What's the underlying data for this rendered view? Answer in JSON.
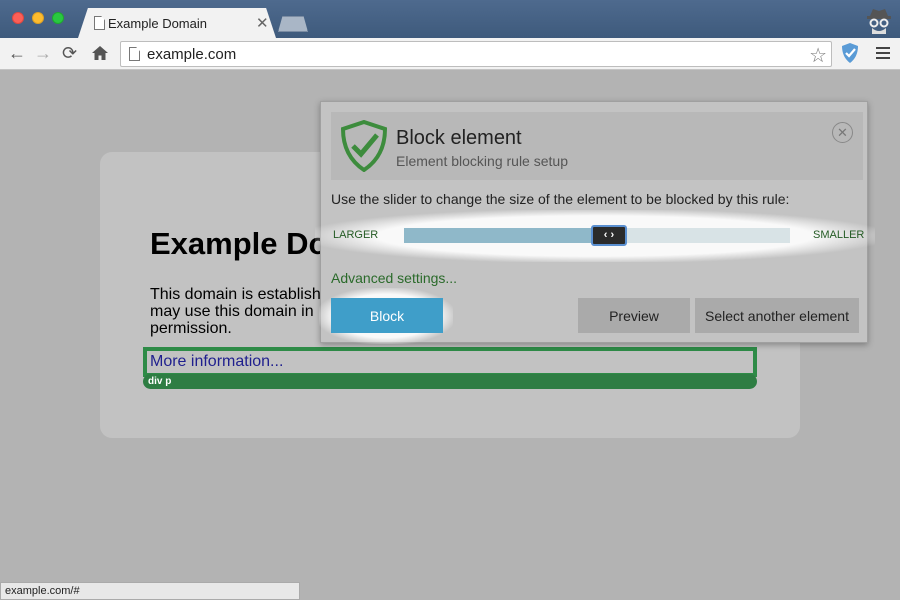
{
  "browser": {
    "tab_title": "Example Domain",
    "tab_close": "✕",
    "url": "example.com",
    "nav": {
      "back": "←",
      "forward": "→",
      "reload": "⟳"
    },
    "star": "☆"
  },
  "page": {
    "heading": "Example Do",
    "paragraph": "This domain is establish may use this domain in permission.",
    "link": "More information...",
    "selector_tag": "div p"
  },
  "status_bar": {
    "text": "example.com/#"
  },
  "dialog": {
    "title": "Block element",
    "subtitle": "Element blocking rule setup",
    "close": "✕",
    "instruction": "Use the slider to change the size of the element to be blocked by this rule:",
    "slider": {
      "left_label": "LARGER",
      "right_label": "SMALLER",
      "handle_glyph": "‹ ›",
      "position_fraction": 0.5
    },
    "advanced_link": "Advanced settings...",
    "buttons": {
      "block": "Block",
      "preview": "Preview",
      "select_another": "Select another element"
    }
  },
  "colors": {
    "accent_green": "#2e8b47",
    "block_button": "#3f9ec9",
    "slider_fill": "#8fb8c9",
    "slider_track": "#d8e3e6"
  },
  "icons": {
    "tab": "page-icon",
    "incognito": "incognito-icon",
    "home": "home-icon",
    "bookmark": "star-icon",
    "extension": "adguard-shield-icon",
    "menu": "hamburger-menu-icon",
    "logo": "adguard-logo-icon"
  }
}
